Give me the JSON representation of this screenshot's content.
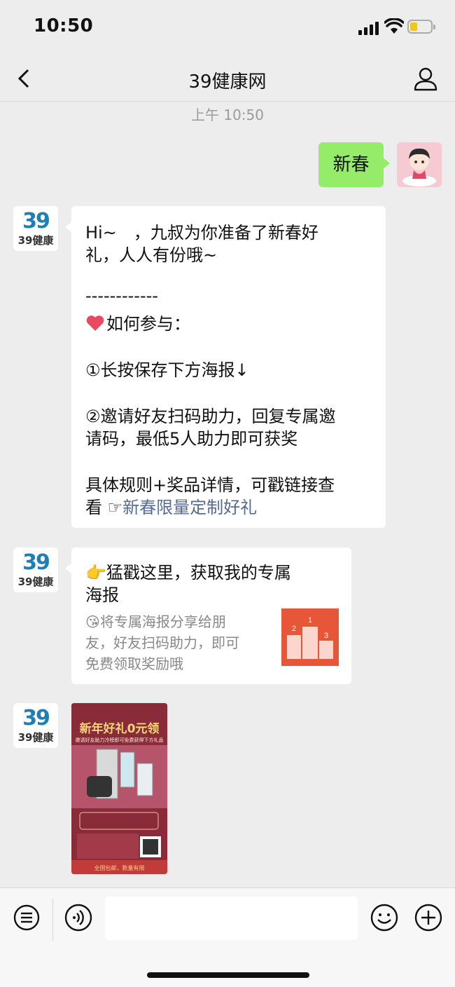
{
  "status_bar": {
    "time": "10:50",
    "battery_level": 0.35,
    "battery_color": "#f2c71a"
  },
  "header": {
    "title": "39健康网",
    "back_icon": "chevron-left-icon",
    "profile_icon": "person-icon"
  },
  "chat": {
    "timestamp": "上午 10:50",
    "sent": {
      "text": "新春",
      "bubble_color": "#95ec69"
    },
    "contact_avatar": {
      "numeral": "39",
      "name": "39健康"
    },
    "message1": {
      "lines": [
        "Hi~　，九叔为你准备了新春好",
        "礼，人人有份哦~",
        "------------",
        "如何参与：",
        "①长按保存下方海报↓",
        "②邀请好友扫码助力，回复专属邀",
        "请码，最低5人助力即可获奖",
        "具体规则+奖品详情，可戳链接查",
        "看 ☞"
      ],
      "link_text": "新春限量定制好礼",
      "link_color": "#576b95"
    },
    "message2": {
      "title_lines": [
        "👉猛戳这里，获取我的专属",
        "海报"
      ],
      "desc_lines": [
        "😘将专属海报分享给朋",
        "友，好友扫码助力，即可",
        "免费领取奖励哦"
      ],
      "thumb_labels": [
        "2",
        "1",
        "3"
      ],
      "thumb_color": "#e8563a"
    },
    "poster": {
      "title": "新年好礼0元领",
      "subtitle": "邀请好友助力冷榜即可免费获得下方礼品",
      "footer": "全国包邮，数量有限"
    }
  },
  "input_bar": {
    "menu_icon": "menu-list-icon",
    "voice_icon": "voice-icon",
    "emoji_icon": "emoji-icon",
    "plus_icon": "plus-icon"
  }
}
